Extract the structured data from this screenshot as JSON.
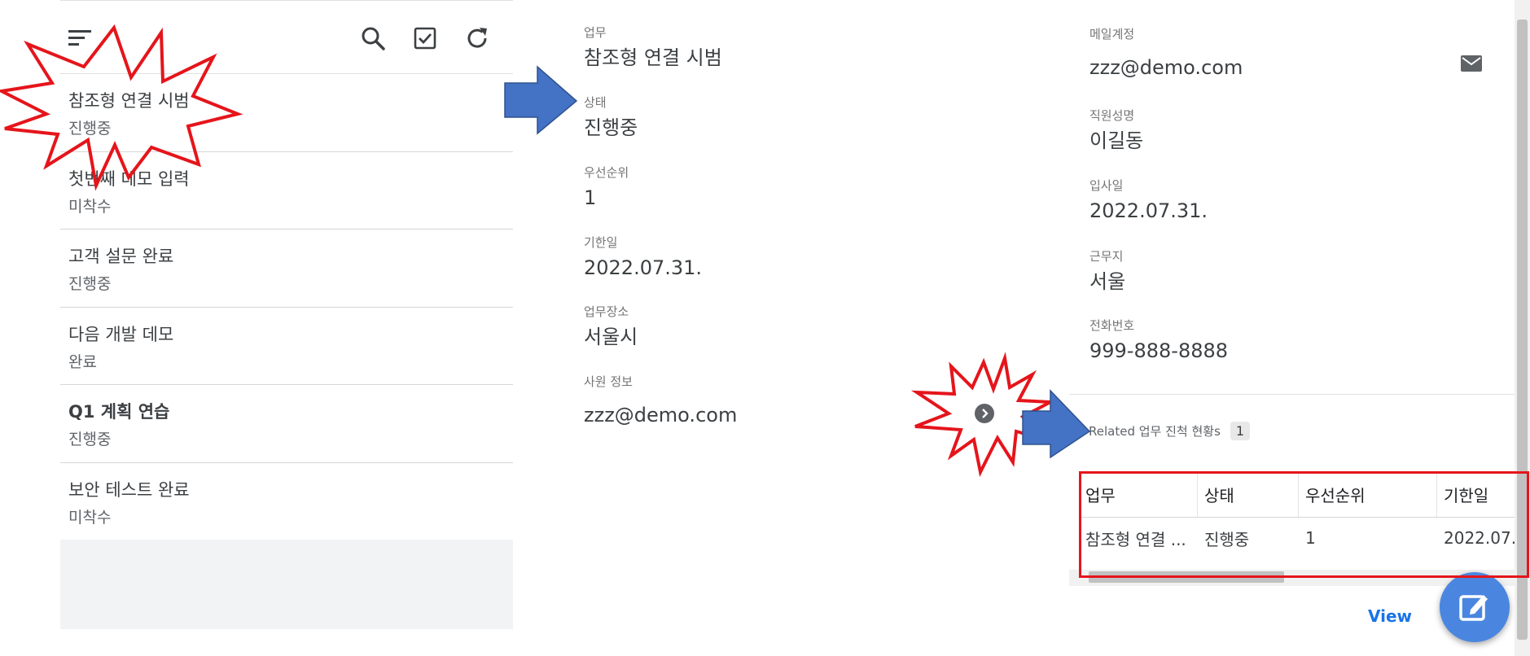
{
  "list": {
    "items": [
      {
        "title": "참조형 연결 시범",
        "status": "진행중",
        "bold": false
      },
      {
        "title": "첫번째 데모 입력",
        "status": "미착수",
        "bold": false
      },
      {
        "title": "고객 설문 완료",
        "status": "진행중",
        "bold": false
      },
      {
        "title": "다음 개발 데모",
        "status": "완료",
        "bold": false
      },
      {
        "title": "Q1 계획 연습",
        "status": "진행중",
        "bold": true
      },
      {
        "title": "보안 테스트 완료",
        "status": "미착수",
        "bold": false
      }
    ]
  },
  "detail": {
    "task": {
      "label": "업무",
      "value": "참조형 연결 시범"
    },
    "status": {
      "label": "상태",
      "value": "진행중"
    },
    "priority": {
      "label": "우선순위",
      "value": "1"
    },
    "due": {
      "label": "기한일",
      "value": "2022.07.31."
    },
    "location": {
      "label": "업무장소",
      "value": "서울시"
    },
    "employee": {
      "label": "사원 정보",
      "value": "zzz@demo.com"
    }
  },
  "employee": {
    "email": {
      "label": "메일계정",
      "value": "zzz@demo.com"
    },
    "name": {
      "label": "직원성명",
      "value": "이길동"
    },
    "joined": {
      "label": "입사일",
      "value": "2022.07.31."
    },
    "workplace": {
      "label": "근무지",
      "value": "서울"
    },
    "phone": {
      "label": "전화번호",
      "value": "999-888-8888"
    }
  },
  "related": {
    "label": "Related 업무 진척 현황s",
    "count": "1",
    "columns": [
      "업무",
      "상태",
      "우선순위",
      "기한일"
    ],
    "rows": [
      [
        "참조형 연결 ...",
        "진행중",
        "1",
        "2022.07."
      ]
    ]
  },
  "actions": {
    "view": "View"
  },
  "colors": {
    "accent": "#1a73e8",
    "fab": "#4a86e0",
    "annotation_red": "#e5151b",
    "annotation_arrow": "#4472c4"
  },
  "icons": [
    "menu-icon",
    "search-icon",
    "checkbox-icon",
    "refresh-icon",
    "mail-icon",
    "chevron-right-icon",
    "edit-icon"
  ]
}
